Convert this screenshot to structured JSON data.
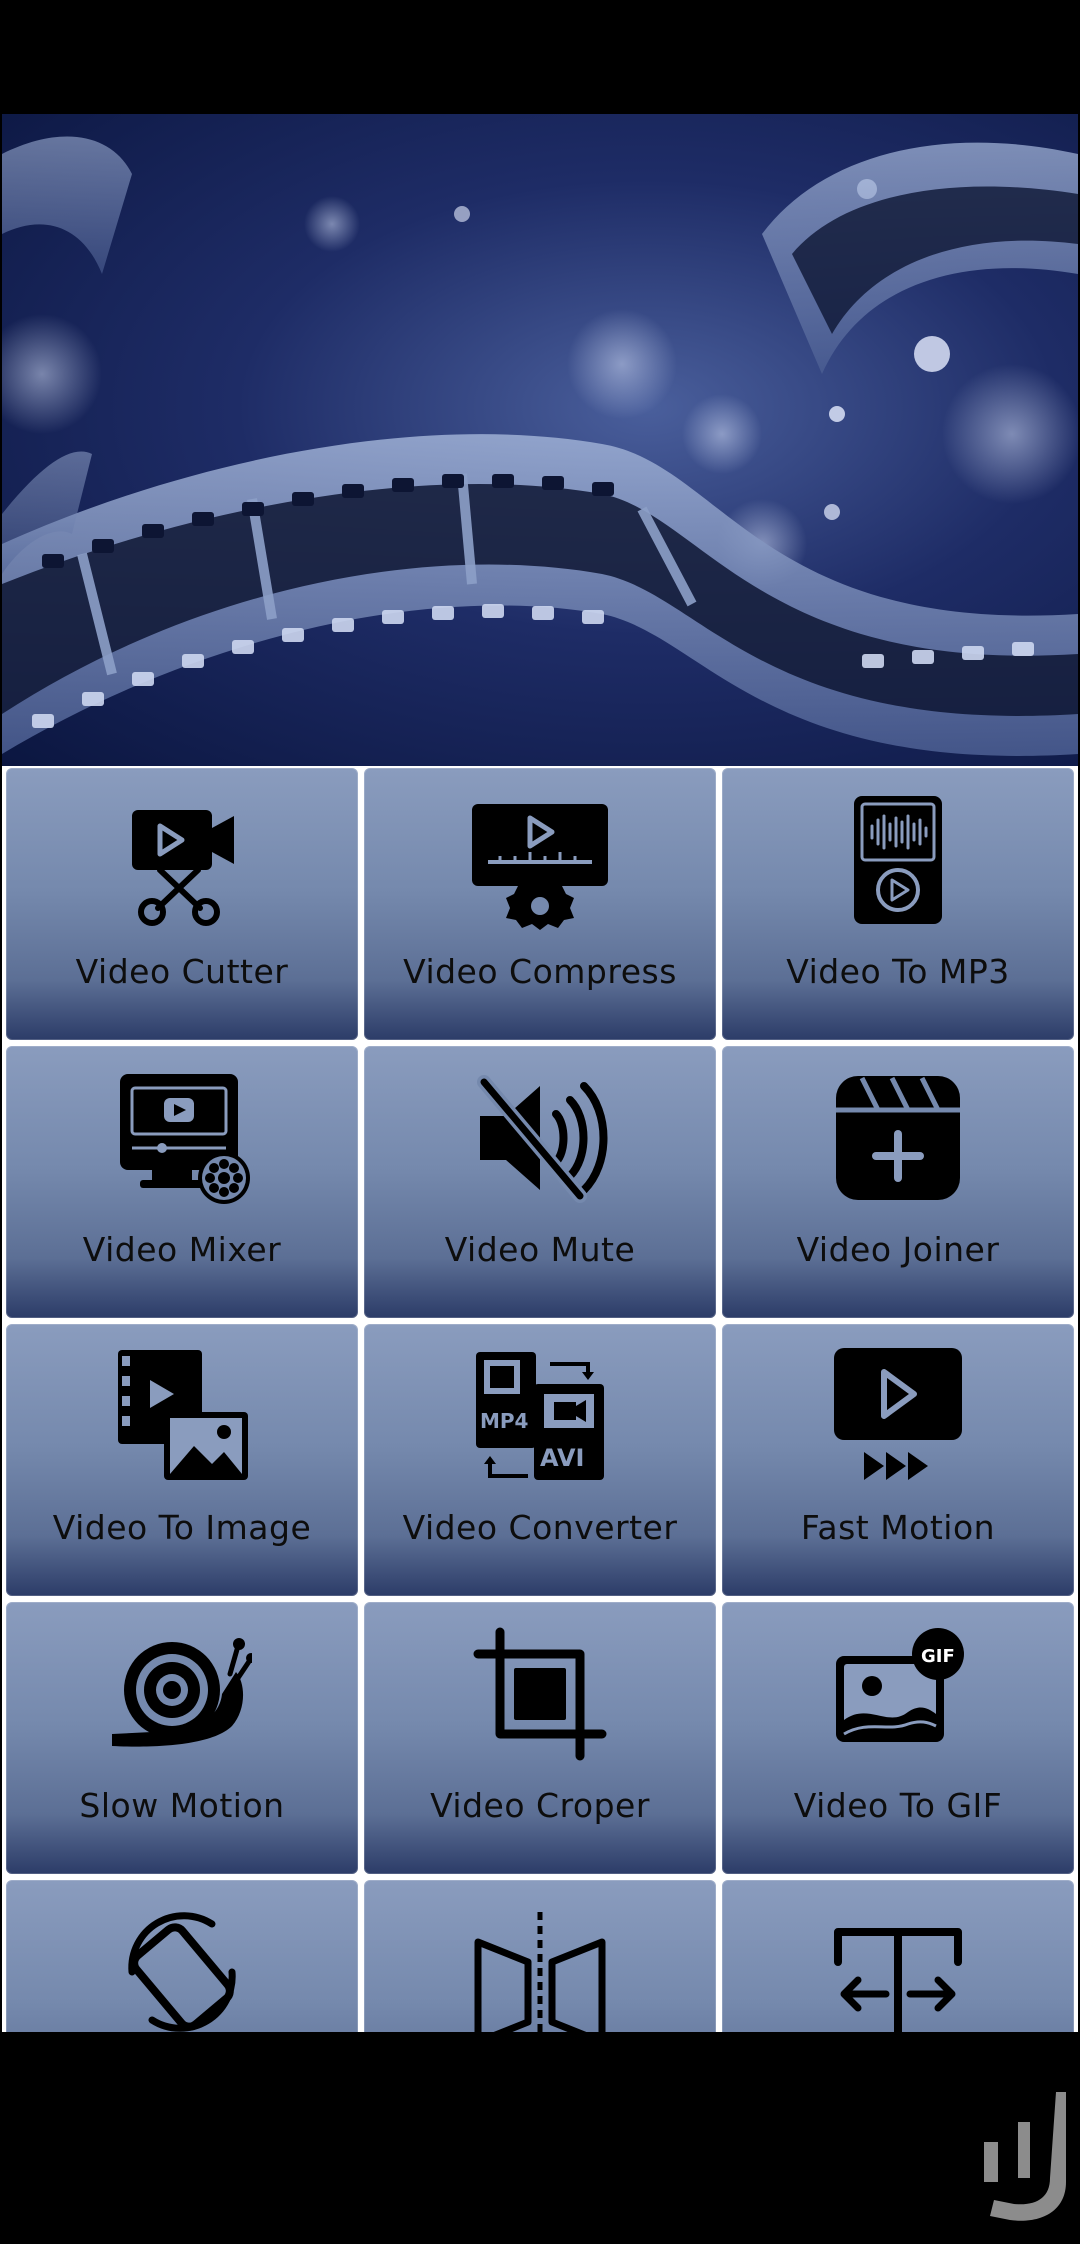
{
  "colors": {
    "tile_top": "#8a9cbe",
    "tile_bottom": "#2c3c68",
    "banner_dark": "#0b1640",
    "banner_mid": "#1e2c66",
    "label_text": "#0d0d0d",
    "frame": "#000000"
  },
  "banner": {
    "icon": "film-strip-bokeh-image"
  },
  "tools": [
    {
      "label": "Video Cutter",
      "icon": "video-cutter-icon"
    },
    {
      "label": "Video Compress",
      "icon": "video-compress-icon"
    },
    {
      "label": "Video To MP3",
      "icon": "video-to-mp3-icon"
    },
    {
      "label": "Video Mixer",
      "icon": "video-mixer-icon"
    },
    {
      "label": "Video Mute",
      "icon": "video-mute-icon"
    },
    {
      "label": "Video Joiner",
      "icon": "video-joiner-icon"
    },
    {
      "label": "Video To Image",
      "icon": "video-to-image-icon"
    },
    {
      "label": "Video Converter",
      "icon": "video-converter-icon"
    },
    {
      "label": "Fast Motion",
      "icon": "fast-motion-icon"
    },
    {
      "label": "Slow Motion",
      "icon": "slow-motion-icon"
    },
    {
      "label": "Video Croper",
      "icon": "video-crop-icon"
    },
    {
      "label": "Video To GIF",
      "icon": "video-to-gif-icon"
    },
    {
      "label": "",
      "icon": "rotate-phone-icon"
    },
    {
      "label": "",
      "icon": "mirror-flip-icon"
    },
    {
      "label": "",
      "icon": "split-resize-icon"
    }
  ],
  "converter_icon_text": {
    "left": "MP4",
    "right": "AVI"
  },
  "gif_badge": "GIF",
  "watermark": {
    "icon": "store-watermark-icon"
  }
}
